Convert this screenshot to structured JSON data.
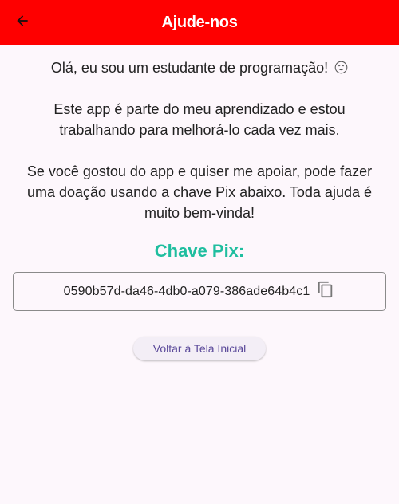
{
  "app_bar": {
    "title": "Ajude-nos",
    "back_icon": "arrow-left-icon"
  },
  "main": {
    "intro": "Olá, eu sou um estudante de programação!",
    "intro_emoji": "smiling-face-icon",
    "paragraph_2": "Este app é parte do meu aprendizado e estou trabalhando para melhorá-lo cada vez mais.",
    "paragraph_3": "Se você gostou do app e quiser me apoiar, pode fazer uma doação usando a chave Pix abaixo. Toda ajuda é muito bem-vinda!",
    "pix_heading": "Chave Pix:",
    "pix_key": "0590b57d-da46-4db0-a079-386ade64b4c1",
    "copy_icon": "copy-icon",
    "home_button_label": "Voltar à Tela Inicial"
  },
  "colors": {
    "app_bar": "#fe0000",
    "background": "#fdf7fc",
    "pix_heading": "#1fbe9f",
    "button_text": "#5b4a9a"
  }
}
